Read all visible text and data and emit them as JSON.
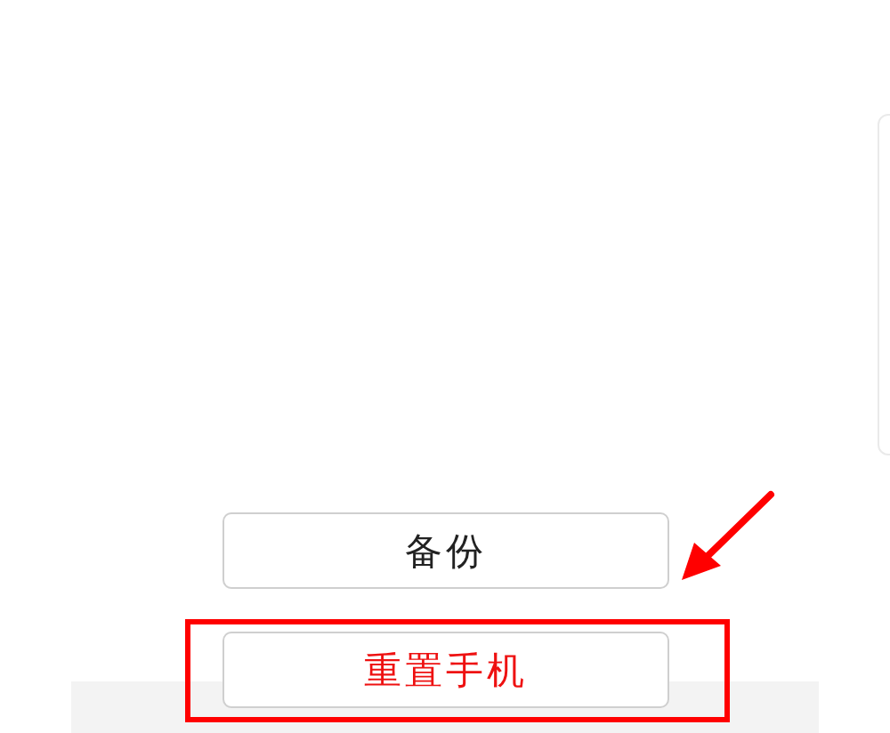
{
  "buttons": [
    {
      "label": "备份",
      "kind": "normal",
      "highlighted": false
    },
    {
      "label": "重置手机",
      "kind": "danger",
      "highlighted": true
    }
  ]
}
